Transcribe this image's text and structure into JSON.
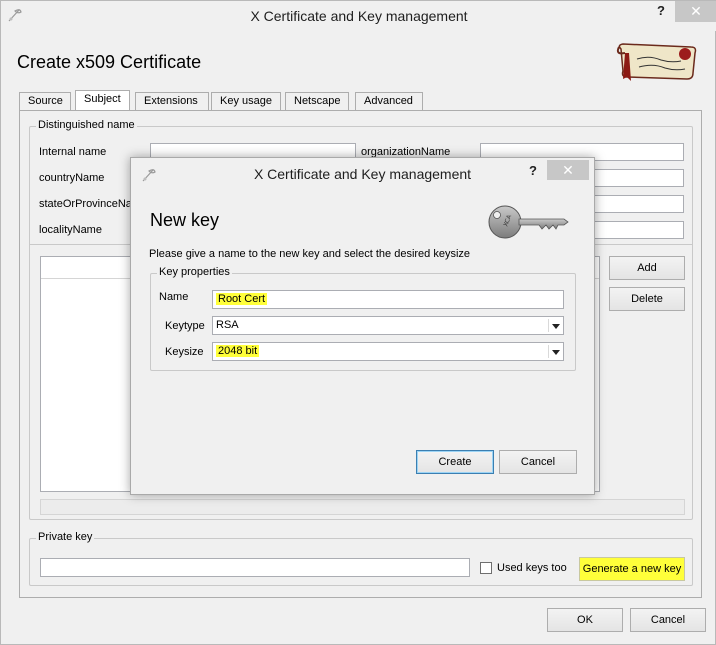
{
  "window": {
    "title": "X Certificate and Key management",
    "help_label": "?",
    "close_label": "✕",
    "heading": "Create x509 Certificate"
  },
  "tabs": [
    {
      "label": "Source",
      "active": false
    },
    {
      "label": "Subject",
      "active": true
    },
    {
      "label": "Extensions",
      "active": false
    },
    {
      "label": "Key usage",
      "active": false
    },
    {
      "label": "Netscape",
      "active": false
    },
    {
      "label": "Advanced",
      "active": false
    }
  ],
  "subject": {
    "group_label": "Distinguished name",
    "fields": {
      "internal_name": {
        "label": "Internal name",
        "value": ""
      },
      "organization_name": {
        "label": "organizationName",
        "value": ""
      },
      "country_name": {
        "label": "countryName",
        "value": ""
      },
      "state_or_province": {
        "label": "stateOrProvinceNa",
        "value": ""
      },
      "locality_name": {
        "label": "localityName",
        "value": ""
      }
    },
    "add_label": "Add",
    "delete_label": "Delete"
  },
  "private_key": {
    "group_label": "Private key",
    "selected": "",
    "used_keys_label": "Used keys too",
    "used_keys_checked": false,
    "generate_label": "Generate a new key"
  },
  "footer": {
    "ok_label": "OK",
    "cancel_label": "Cancel"
  },
  "dialog": {
    "title": "X Certificate and Key management",
    "help_label": "?",
    "close_label": "✕",
    "heading": "New key",
    "description": "Please give a name to the new key and select the desired keysize",
    "group_label": "Key properties",
    "name_label": "Name",
    "name_value": "Root Cert",
    "keytype_label": "Keytype",
    "keytype_value": "RSA",
    "keysize_label": "Keysize",
    "keysize_value": "2048 bit",
    "create_label": "Create",
    "cancel_label": "Cancel"
  },
  "colors": {
    "highlight": "#ffff3a",
    "window_bg": "#f0f0f0",
    "close_bg": "#c7c7c7"
  }
}
